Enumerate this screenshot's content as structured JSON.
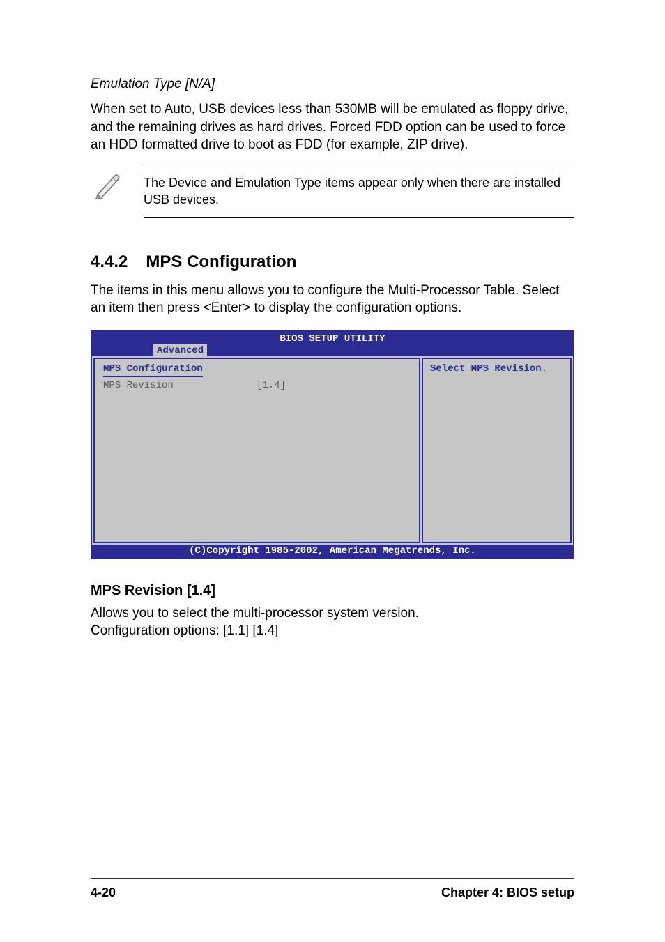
{
  "emulation": {
    "heading": "Emulation Type [N/A]",
    "body": "When set to Auto, USB devices less than 530MB will be emulated as floppy drive, and the remaining drives as hard drives. Forced FDD option can be used to force an HDD formatted drive to boot as FDD (for example, ZIP drive)."
  },
  "note": {
    "text": "The Device and Emulation Type items appear only when there are installed USB devices."
  },
  "section": {
    "number": "4.4.2",
    "title": "MPS Configuration",
    "intro": "The items in this menu allows you to configure the Multi-Processor Table. Select an item then press <Enter> to display the configuration options."
  },
  "bios": {
    "header_title": "BIOS SETUP UTILITY",
    "tab": "Advanced",
    "left_title": "MPS Configuration",
    "row_label": "MPS Revision",
    "row_value": "[1.4]",
    "right_text": "Select MPS Revision.",
    "footer": "(C)Copyright 1985-2002, American Megatrends, Inc."
  },
  "option": {
    "heading": "MPS Revision [1.4]",
    "line1": "Allows you to select the multi-processor system version.",
    "line2": "Configuration options: [1.1] [1.4]"
  },
  "footer": {
    "page": "4-20",
    "chapter": "Chapter 4: BIOS setup"
  }
}
